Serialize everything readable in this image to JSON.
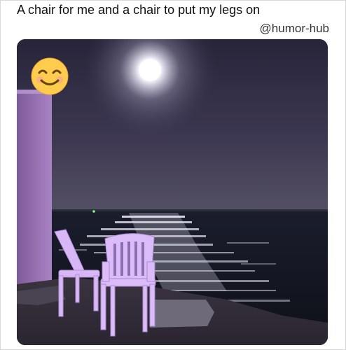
{
  "post": {
    "caption": "A chair for me and a chair to put my legs on",
    "handle": "@humor-hub"
  },
  "photo": {
    "scene": "night-sea-moon-chairs",
    "colors": {
      "sky_top": "#2a2a3e",
      "sky_bottom": "#4a4458",
      "sea": "#141824",
      "moon": "#fffef0",
      "chairs": "#d9b7f7",
      "wall": "#8f6aa8"
    }
  },
  "overlay": {
    "icon": "smiling-face-emoji"
  }
}
